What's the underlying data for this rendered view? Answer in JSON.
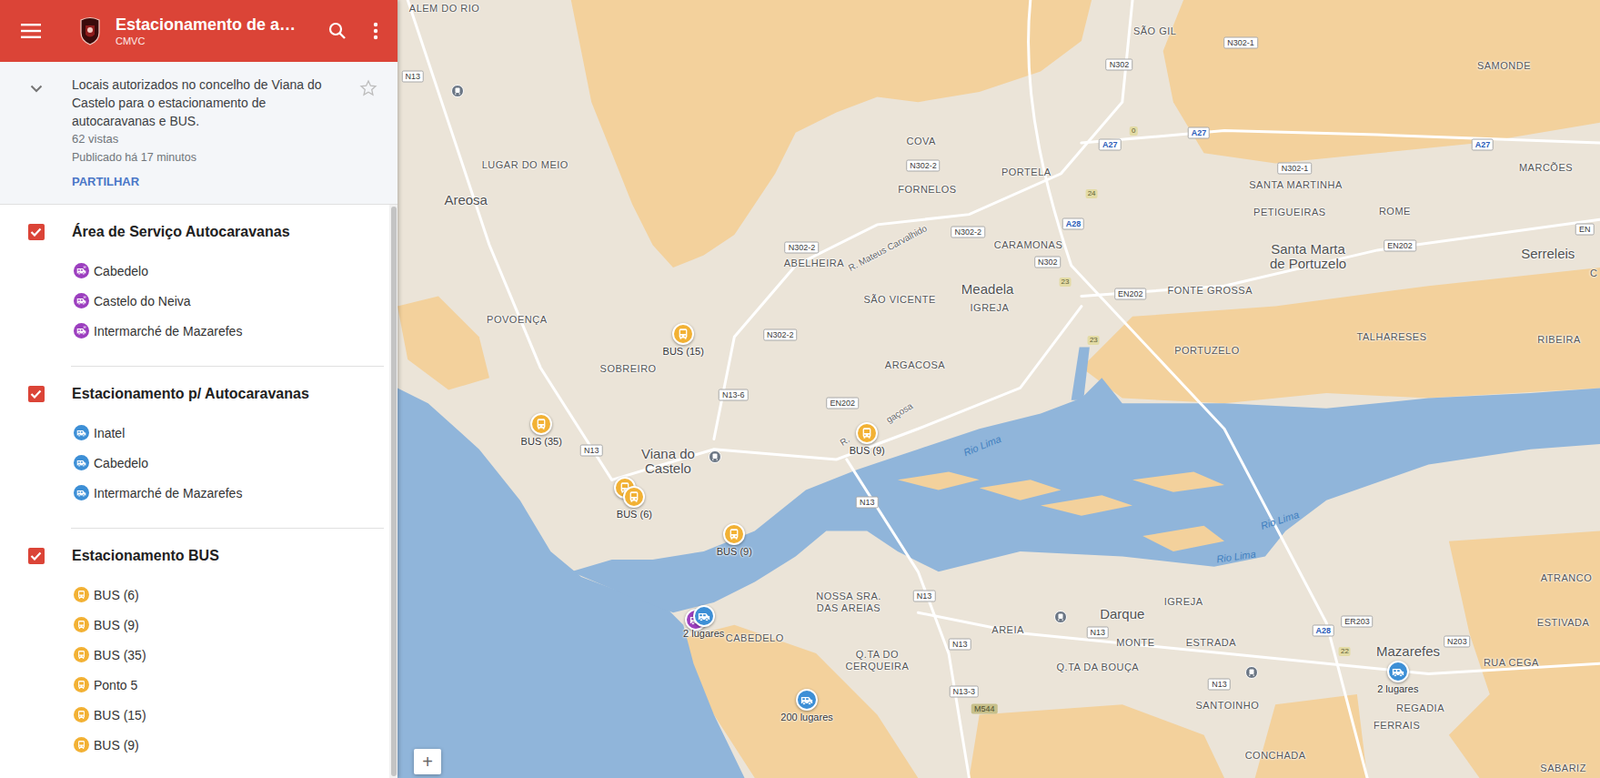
{
  "header": {
    "title": "Estacionamento de a…",
    "subtitle": "CMVC"
  },
  "map_info": {
    "description": "Locais autorizados no concelho de Viana do Castelo para o estacionamento de autocaravanas e BUS.",
    "views": "62 vistas",
    "published": "Publicado há 17 minutos",
    "share": "PARTILHAR",
    "expanded": true,
    "starred": false
  },
  "layers": [
    {
      "title": "Área de Serviço Autocaravanas",
      "checked": true,
      "items": [
        {
          "name": "Cabedelo",
          "kind": "service",
          "color": "#9c3fbf"
        },
        {
          "name": "Castelo do Neiva",
          "kind": "service",
          "color": "#9c3fbf"
        },
        {
          "name": "Intermarché de Mazarefes",
          "kind": "service",
          "color": "#9c3fbf"
        }
      ]
    },
    {
      "title": "Estacionamento p/ Autocaravanas",
      "checked": true,
      "items": [
        {
          "name": "Inatel",
          "kind": "motorhome",
          "color": "#3d8fd6"
        },
        {
          "name": "Cabedelo",
          "kind": "motorhome",
          "color": "#3d8fd6"
        },
        {
          "name": "Intermarché de Mazarefes",
          "kind": "motorhome",
          "color": "#3d8fd6"
        }
      ]
    },
    {
      "title": "Estacionamento BUS",
      "checked": true,
      "items": [
        {
          "name": "BUS (6)",
          "kind": "bus",
          "color": "#f2b134"
        },
        {
          "name": "BUS (9)",
          "kind": "bus",
          "color": "#f2b134"
        },
        {
          "name": "BUS (35)",
          "kind": "bus",
          "color": "#f2b134"
        },
        {
          "name": "Ponto 5",
          "kind": "bus",
          "color": "#f2b134"
        },
        {
          "name": "BUS (15)",
          "kind": "bus",
          "color": "#f2b134"
        },
        {
          "name": "BUS (9)",
          "kind": "bus",
          "color": "#f2b134"
        }
      ]
    }
  ],
  "map": {
    "zoom_in": "+",
    "labels": [
      {
        "text": "ALEM DO RIO",
        "kind": "place"
      },
      {
        "text": "SÃO GIL",
        "kind": "place"
      },
      {
        "text": "COVA",
        "kind": "place"
      },
      {
        "text": "LUGAR DO MEIO",
        "kind": "place"
      },
      {
        "text": "SAMONDE",
        "kind": "place"
      },
      {
        "text": "MARCÕES",
        "kind": "place"
      },
      {
        "text": "PORTELA",
        "kind": "place"
      },
      {
        "text": "FORNELOS",
        "kind": "place"
      },
      {
        "text": "SANTA MARTINHA",
        "kind": "place"
      },
      {
        "text": "CARAMONAS",
        "kind": "place"
      },
      {
        "text": "PETIGUEIRAS",
        "kind": "place"
      },
      {
        "text": "ROME",
        "kind": "place"
      },
      {
        "text": "ABELHEIRA",
        "kind": "place"
      },
      {
        "text": "IGREJA",
        "kind": "place"
      },
      {
        "text": "POVOENÇA",
        "kind": "place"
      },
      {
        "text": "SÃO VICENTE",
        "kind": "place"
      },
      {
        "text": "FONTE GROSSA",
        "kind": "place"
      },
      {
        "text": "TALHARESES",
        "kind": "place"
      },
      {
        "text": "RIBEIRA",
        "kind": "place"
      },
      {
        "text": "SOBREIRO",
        "kind": "place"
      },
      {
        "text": "ARGACOSA",
        "kind": "place"
      },
      {
        "text": "PORTUZELO",
        "kind": "place"
      },
      {
        "text": "NOSSA SRA. DAS AREIAS",
        "kind": "place"
      },
      {
        "text": "IGREJA",
        "kind": "place"
      },
      {
        "text": "ESTRADA",
        "kind": "place"
      },
      {
        "text": "RUA CEGA",
        "kind": "place"
      },
      {
        "text": "ATRANCO",
        "kind": "place"
      },
      {
        "text": "ESTIVADA",
        "kind": "place"
      },
      {
        "text": "CABEDELO",
        "kind": "place"
      },
      {
        "text": "Q.TA DO CERQUEIRA",
        "kind": "place"
      },
      {
        "text": "AREIA",
        "kind": "place"
      },
      {
        "text": "MONTE",
        "kind": "place"
      },
      {
        "text": "Q.TA DA BOUÇA",
        "kind": "place"
      },
      {
        "text": "REGADIA",
        "kind": "place"
      },
      {
        "text": "SANTOINHO",
        "kind": "place"
      },
      {
        "text": "FERRAIS",
        "kind": "place"
      },
      {
        "text": "CONCHADA",
        "kind": "place"
      },
      {
        "text": "SABARIZ",
        "kind": "place"
      },
      {
        "text": "C",
        "kind": "place"
      },
      {
        "text": "Areosa",
        "kind": "town"
      },
      {
        "text": "Meadela",
        "kind": "town"
      },
      {
        "text": "Santa Marta de Portuzelo",
        "kind": "town"
      },
      {
        "text": "Serreleis",
        "kind": "town"
      },
      {
        "text": "Viana do Castelo",
        "kind": "town"
      },
      {
        "text": "Darque",
        "kind": "town"
      },
      {
        "text": "Mazarefes",
        "kind": "town"
      },
      {
        "text": "N302-1",
        "kind": "road"
      },
      {
        "text": "N13",
        "kind": "road"
      },
      {
        "text": "N302",
        "kind": "road"
      },
      {
        "text": "N302-1",
        "kind": "road"
      },
      {
        "text": "N302-2",
        "kind": "road"
      },
      {
        "text": "N302-2",
        "kind": "road"
      },
      {
        "text": "N302-2",
        "kind": "road"
      },
      {
        "text": "N302",
        "kind": "road"
      },
      {
        "text": "EN202",
        "kind": "road"
      },
      {
        "text": "EN202",
        "kind": "road"
      },
      {
        "text": "EN",
        "kind": "road"
      },
      {
        "text": "N302-2",
        "kind": "road"
      },
      {
        "text": "N13-6",
        "kind": "road"
      },
      {
        "text": "EN202",
        "kind": "road"
      },
      {
        "text": "N13",
        "kind": "road"
      },
      {
        "text": "N13",
        "kind": "road"
      },
      {
        "text": "N13",
        "kind": "road"
      },
      {
        "text": "ER203",
        "kind": "road"
      },
      {
        "text": "N203",
        "kind": "road"
      },
      {
        "text": "N13",
        "kind": "road"
      },
      {
        "text": "N13",
        "kind": "road"
      },
      {
        "text": "N13-3",
        "kind": "road"
      },
      {
        "text": "N13",
        "kind": "road"
      },
      {
        "text": "M544",
        "kind": "municipal"
      },
      {
        "text": "A27",
        "kind": "motorway"
      },
      {
        "text": "A27",
        "kind": "motorway"
      },
      {
        "text": "A27",
        "kind": "motorway"
      },
      {
        "text": "A28",
        "kind": "motorway"
      },
      {
        "text": "A28",
        "kind": "motorway"
      },
      {
        "text": "24",
        "kind": "exit"
      },
      {
        "text": "23",
        "kind": "exit"
      },
      {
        "text": "23",
        "kind": "exit"
      },
      {
        "text": "22",
        "kind": "exit"
      },
      {
        "text": "0",
        "kind": "exit"
      },
      {
        "text": "R. Mateus Carvalhido",
        "kind": "street"
      },
      {
        "text": "R.",
        "kind": "street"
      },
      {
        "text": "gaçosa",
        "kind": "street"
      },
      {
        "text": "Rio Lima",
        "kind": "river"
      },
      {
        "text": "Rio Lima",
        "kind": "river"
      },
      {
        "text": "Rio Lima",
        "kind": "river"
      }
    ],
    "pins": [
      {
        "label": "BUS (15)",
        "kind": "bus",
        "color": "#f2b134"
      },
      {
        "label": "BUS (35)",
        "kind": "bus",
        "color": "#f2b134"
      },
      {
        "kind": "bus",
        "color": "#f2b134"
      },
      {
        "label": "BUS (6)",
        "kind": "bus",
        "color": "#f2b134"
      },
      {
        "label": "BUS (9)",
        "kind": "bus",
        "color": "#f2b134"
      },
      {
        "label": "BUS (9)",
        "kind": "bus",
        "color": "#f2b134"
      },
      {
        "kind": "service",
        "color": "#9c3fbf"
      },
      {
        "label": "2 lugares",
        "kind": "motorhome",
        "color": "#3d8fd6"
      },
      {
        "label": "200 lugares",
        "kind": "motorhome",
        "color": "#3d8fd6"
      },
      {
        "label": "2 lugares",
        "kind": "motorhome",
        "color": "#3d8fd6"
      }
    ]
  }
}
